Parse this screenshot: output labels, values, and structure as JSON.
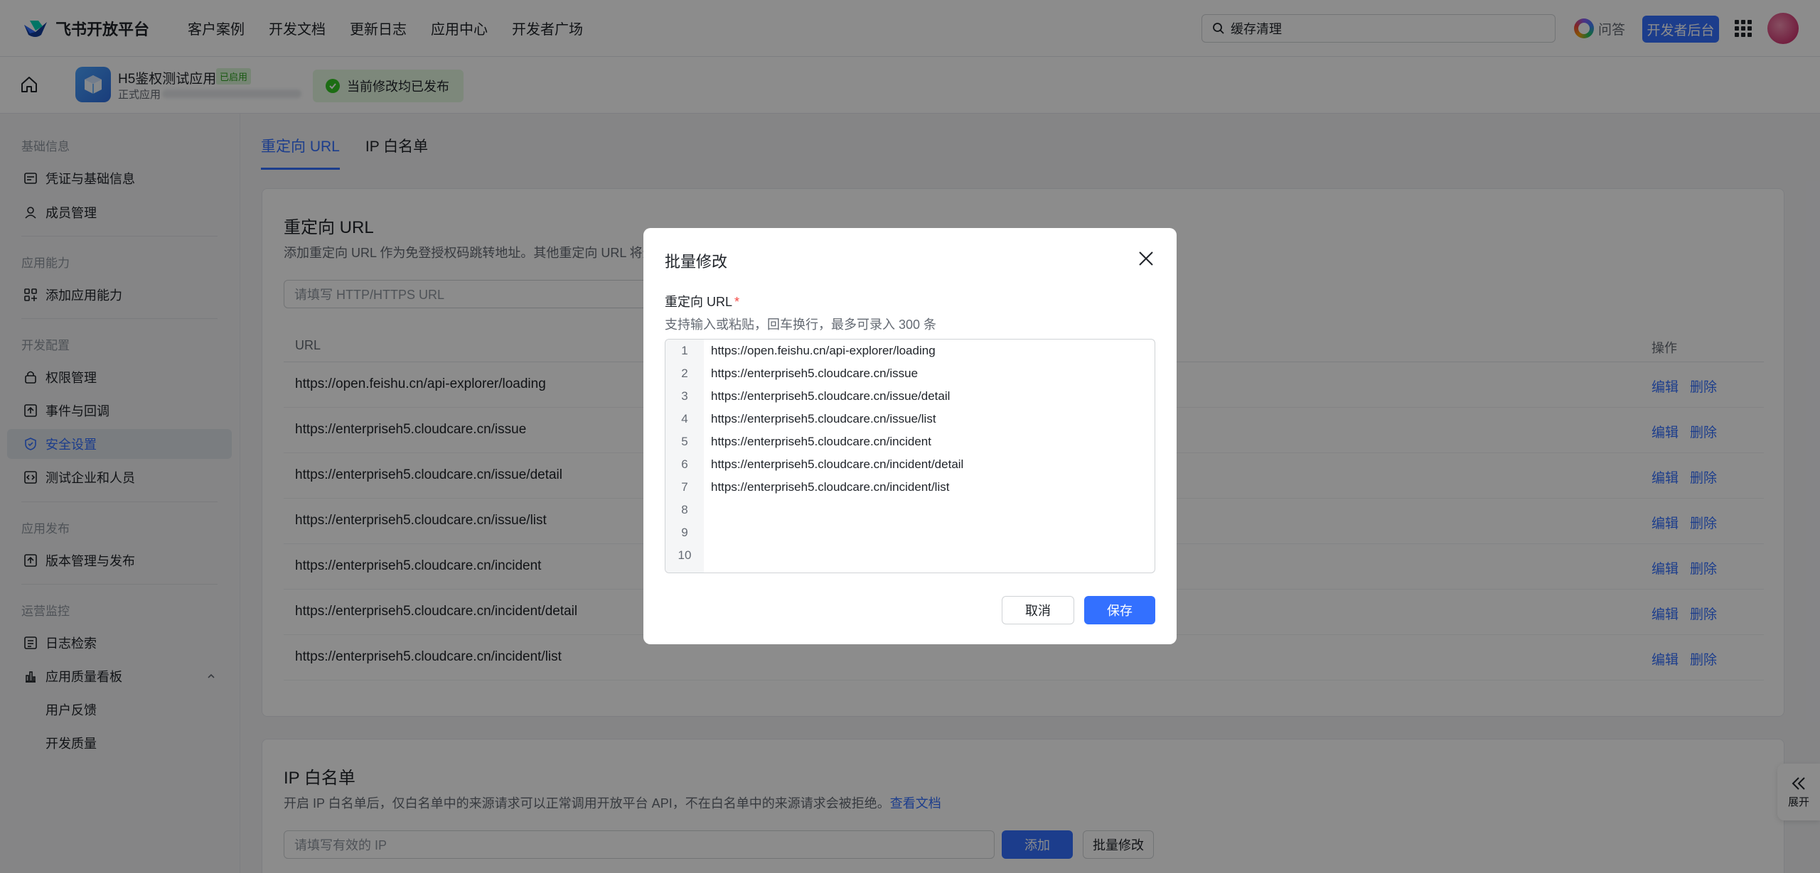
{
  "topnav": {
    "brand": "飞书开放平台",
    "links": [
      "客户案例",
      "开发文档",
      "更新日志",
      "应用中心",
      "开发者广场"
    ],
    "search_value": "缓存清理",
    "qa_label": "问答",
    "dev_console_label": "开发者后台"
  },
  "app": {
    "name": "H5鉴权测试应用",
    "status_badge": "已启用",
    "sub_label": "正式应用",
    "publish_status": "当前修改均已发布"
  },
  "sidebar": {
    "sections": [
      {
        "title": "基础信息",
        "items": [
          "凭证与基础信息",
          "成员管理"
        ]
      },
      {
        "title": "应用能力",
        "items": [
          "添加应用能力"
        ]
      },
      {
        "title": "开发配置",
        "items": [
          "权限管理",
          "事件与回调",
          "安全设置",
          "测试企业和人员"
        ]
      },
      {
        "title": "应用发布",
        "items": [
          "版本管理与发布"
        ]
      },
      {
        "title": "运营监控",
        "items": [
          "日志检索",
          "应用质量看板",
          "用户反馈",
          "开发质量"
        ]
      }
    ]
  },
  "tabs": [
    "重定向 URL",
    "IP 白名单"
  ],
  "redirect_card": {
    "title": "重定向 URL",
    "desc": "添加重定向 URL 作为免登授权码跳转地址。其他重定向 URL 将无",
    "input_placeholder": "请填写 HTTP/HTTPS URL",
    "col_url": "URL",
    "col_action": "操作",
    "edit_label": "编辑",
    "delete_label": "删除",
    "rows": [
      "https://open.feishu.cn/api-explorer/loading",
      "https://enterpriseh5.cloudcare.cn/issue",
      "https://enterpriseh5.cloudcare.cn/issue/detail",
      "https://enterpriseh5.cloudcare.cn/issue/list",
      "https://enterpriseh5.cloudcare.cn/incident",
      "https://enterpriseh5.cloudcare.cn/incident/detail",
      "https://enterpriseh5.cloudcare.cn/incident/list"
    ]
  },
  "ip_card": {
    "title": "IP 白名单",
    "desc": "开启 IP 白名单后，仅白名单中的来源请求可以正常调用开放平台 API，不在白名单中的来源请求会被拒绝。",
    "doc_link": "查看文档",
    "input_placeholder": "请填写有效的 IP",
    "add_label": "添加",
    "batch_label": "批量修改"
  },
  "expand_label": "展开",
  "modal": {
    "title": "批量修改",
    "field_label": "重定向 URL",
    "required_mark": "*",
    "help": "支持输入或粘贴，回车换行，最多可录入 300 条",
    "line_numbers": [
      "1",
      "2",
      "3",
      "4",
      "5",
      "6",
      "7",
      "8",
      "9",
      "10"
    ],
    "lines": [
      "https://open.feishu.cn/api-explorer/loading",
      "https://enterpriseh5.cloudcare.cn/issue",
      "https://enterpriseh5.cloudcare.cn/issue/detail",
      "https://enterpriseh5.cloudcare.cn/issue/list",
      "https://enterpriseh5.cloudcare.cn/incident",
      "https://enterpriseh5.cloudcare.cn/incident/detail",
      "https://enterpriseh5.cloudcare.cn/incident/list",
      "",
      "",
      ""
    ],
    "cancel_label": "取消",
    "save_label": "保存"
  },
  "colors": {
    "accent": "#3370ff",
    "success": "#34c724",
    "danger": "#f54a45"
  }
}
